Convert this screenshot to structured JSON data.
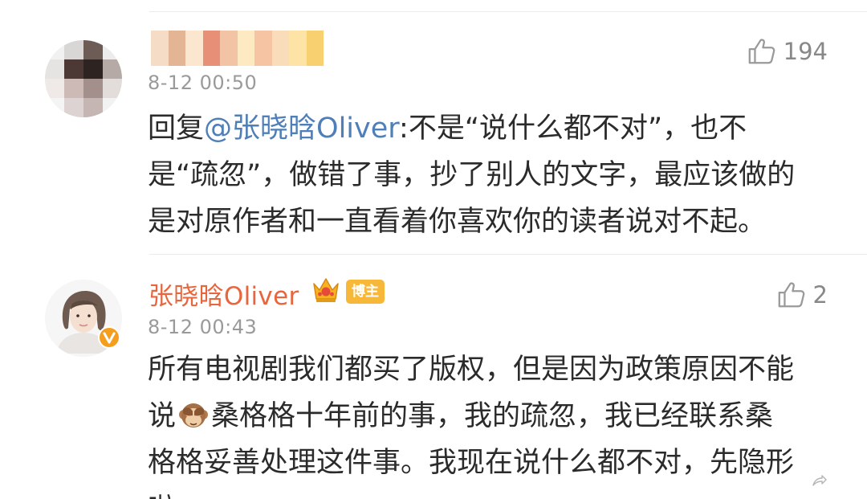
{
  "comments": [
    {
      "username": "",
      "timestamp": "8-12 00:50",
      "likes": "194",
      "reply_prefix": "回复",
      "mention": "@张晓晗Oliver",
      "lines": [
        ":不是“说什么都不对”，也不",
        "是“疏忽”，做错了事，抄了别人的文字，最应该做的",
        "是对原作者和一直看着你喜欢你的读者说对不起。"
      ]
    },
    {
      "username": "张晓晗Oliver",
      "badge": "博主",
      "timestamp": "8-12 00:43",
      "likes": "2",
      "lines": [
        "所有电视剧我们都买了版权，但是因为政策原因不能",
        "说",
        "桑格格十年前的事，我的疏忽，我已经联系桑",
        "格格妥善处理这件事。我现在说什么都不对，先隐形",
        "啦"
      ]
    }
  ],
  "icons": {
    "like": "thumbs-up-icon",
    "crown": "crown-icon",
    "emoji": "see-no-evil-monkey-icon",
    "verified": "verified-v-icon"
  },
  "colors": {
    "username": "#e8653d",
    "mention": "#4f7fb8",
    "badge": "#f7b83a",
    "timestamp": "#9a9a9a"
  }
}
